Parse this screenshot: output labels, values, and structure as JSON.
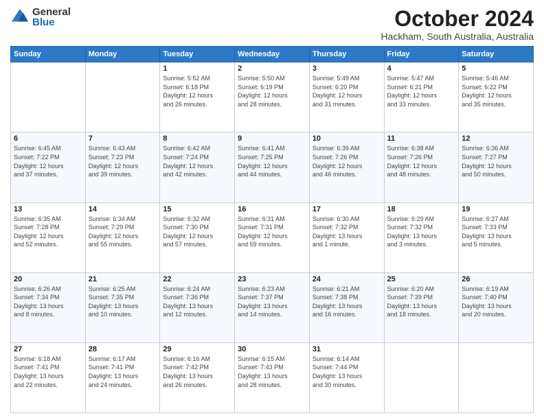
{
  "header": {
    "logo_general": "General",
    "logo_blue": "Blue",
    "title": "October 2024",
    "location": "Hackham, South Australia, Australia"
  },
  "weekdays": [
    "Sunday",
    "Monday",
    "Tuesday",
    "Wednesday",
    "Thursday",
    "Friday",
    "Saturday"
  ],
  "weeks": [
    [
      {
        "day": "",
        "info": ""
      },
      {
        "day": "",
        "info": ""
      },
      {
        "day": "1",
        "info": "Sunrise: 5:52 AM\nSunset: 6:18 PM\nDaylight: 12 hours\nand 26 minutes."
      },
      {
        "day": "2",
        "info": "Sunrise: 5:50 AM\nSunset: 6:19 PM\nDaylight: 12 hours\nand 28 minutes."
      },
      {
        "day": "3",
        "info": "Sunrise: 5:49 AM\nSunset: 6:20 PM\nDaylight: 12 hours\nand 31 minutes."
      },
      {
        "day": "4",
        "info": "Sunrise: 5:47 AM\nSunset: 6:21 PM\nDaylight: 12 hours\nand 33 minutes."
      },
      {
        "day": "5",
        "info": "Sunrise: 5:46 AM\nSunset: 6:22 PM\nDaylight: 12 hours\nand 35 minutes."
      }
    ],
    [
      {
        "day": "6",
        "info": "Sunrise: 6:45 AM\nSunset: 7:22 PM\nDaylight: 12 hours\nand 37 minutes."
      },
      {
        "day": "7",
        "info": "Sunrise: 6:43 AM\nSunset: 7:23 PM\nDaylight: 12 hours\nand 39 minutes."
      },
      {
        "day": "8",
        "info": "Sunrise: 6:42 AM\nSunset: 7:24 PM\nDaylight: 12 hours\nand 42 minutes."
      },
      {
        "day": "9",
        "info": "Sunrise: 6:41 AM\nSunset: 7:25 PM\nDaylight: 12 hours\nand 44 minutes."
      },
      {
        "day": "10",
        "info": "Sunrise: 6:39 AM\nSunset: 7:26 PM\nDaylight: 12 hours\nand 46 minutes."
      },
      {
        "day": "11",
        "info": "Sunrise: 6:38 AM\nSunset: 7:26 PM\nDaylight: 12 hours\nand 48 minutes."
      },
      {
        "day": "12",
        "info": "Sunrise: 6:36 AM\nSunset: 7:27 PM\nDaylight: 12 hours\nand 50 minutes."
      }
    ],
    [
      {
        "day": "13",
        "info": "Sunrise: 6:35 AM\nSunset: 7:28 PM\nDaylight: 12 hours\nand 52 minutes."
      },
      {
        "day": "14",
        "info": "Sunrise: 6:34 AM\nSunset: 7:29 PM\nDaylight: 12 hours\nand 55 minutes."
      },
      {
        "day": "15",
        "info": "Sunrise: 6:32 AM\nSunset: 7:30 PM\nDaylight: 12 hours\nand 57 minutes."
      },
      {
        "day": "16",
        "info": "Sunrise: 6:31 AM\nSunset: 7:31 PM\nDaylight: 12 hours\nand 59 minutes."
      },
      {
        "day": "17",
        "info": "Sunrise: 6:30 AM\nSunset: 7:32 PM\nDaylight: 13 hours\nand 1 minute."
      },
      {
        "day": "18",
        "info": "Sunrise: 6:29 AM\nSunset: 7:32 PM\nDaylight: 13 hours\nand 3 minutes."
      },
      {
        "day": "19",
        "info": "Sunrise: 6:27 AM\nSunset: 7:33 PM\nDaylight: 13 hours\nand 5 minutes."
      }
    ],
    [
      {
        "day": "20",
        "info": "Sunrise: 6:26 AM\nSunset: 7:34 PM\nDaylight: 13 hours\nand 8 minutes."
      },
      {
        "day": "21",
        "info": "Sunrise: 6:25 AM\nSunset: 7:35 PM\nDaylight: 13 hours\nand 10 minutes."
      },
      {
        "day": "22",
        "info": "Sunrise: 6:24 AM\nSunset: 7:36 PM\nDaylight: 13 hours\nand 12 minutes."
      },
      {
        "day": "23",
        "info": "Sunrise: 6:23 AM\nSunset: 7:37 PM\nDaylight: 13 hours\nand 14 minutes."
      },
      {
        "day": "24",
        "info": "Sunrise: 6:21 AM\nSunset: 7:38 PM\nDaylight: 13 hours\nand 16 minutes."
      },
      {
        "day": "25",
        "info": "Sunrise: 6:20 AM\nSunset: 7:39 PM\nDaylight: 13 hours\nand 18 minutes."
      },
      {
        "day": "26",
        "info": "Sunrise: 6:19 AM\nSunset: 7:40 PM\nDaylight: 13 hours\nand 20 minutes."
      }
    ],
    [
      {
        "day": "27",
        "info": "Sunrise: 6:18 AM\nSunset: 7:41 PM\nDaylight: 13 hours\nand 22 minutes."
      },
      {
        "day": "28",
        "info": "Sunrise: 6:17 AM\nSunset: 7:41 PM\nDaylight: 13 hours\nand 24 minutes."
      },
      {
        "day": "29",
        "info": "Sunrise: 6:16 AM\nSunset: 7:42 PM\nDaylight: 13 hours\nand 26 minutes."
      },
      {
        "day": "30",
        "info": "Sunrise: 6:15 AM\nSunset: 7:43 PM\nDaylight: 13 hours\nand 28 minutes."
      },
      {
        "day": "31",
        "info": "Sunrise: 6:14 AM\nSunset: 7:44 PM\nDaylight: 13 hours\nand 30 minutes."
      },
      {
        "day": "",
        "info": ""
      },
      {
        "day": "",
        "info": ""
      }
    ]
  ]
}
